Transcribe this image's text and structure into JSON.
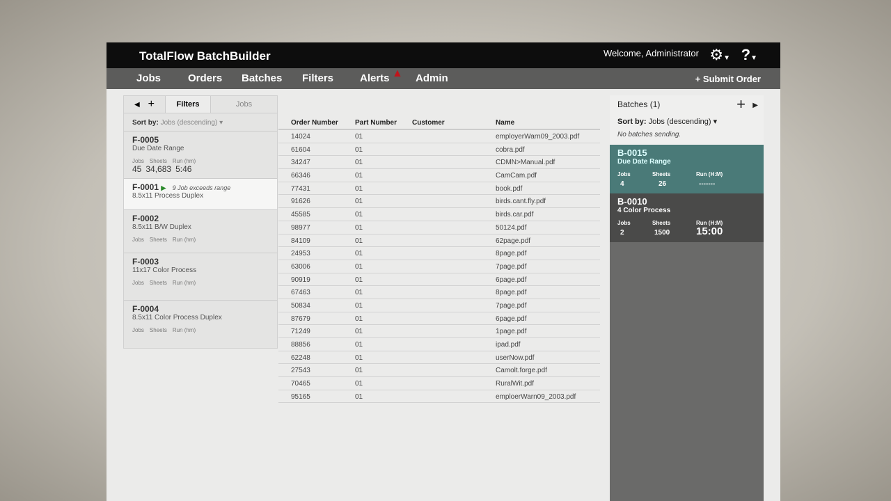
{
  "app": {
    "title": "TotalFlow BatchBuilder",
    "welcome": "Welcome, Administrator",
    "gear_icon": "gear-icon",
    "help_icon": "help-icon"
  },
  "nav": {
    "items": [
      "Jobs",
      "Orders",
      "Batches",
      "Filters",
      "Alerts",
      "Admin"
    ],
    "submit": "+ Submit Order",
    "alert_icon": "warning-icon",
    "alert_color": "#c0141b"
  },
  "filters": {
    "tabs": [
      "Filters",
      "Jobs"
    ],
    "sort_label": "Sort by:",
    "sort_value": "Jobs (descending)",
    "labels": {
      "jobs": "Jobs",
      "sheets": "Sheets",
      "run": "Run (hm)"
    },
    "items": [
      {
        "id": "F-0005",
        "name": "Due Date Range",
        "jobs": "45",
        "sheets": "34,683",
        "run": "5:46"
      },
      {
        "id": "F-0001",
        "name": "8.5x11 Process Duplex",
        "warning": "9 Job exceeds range"
      },
      {
        "id": "F-0002",
        "name": "8.5x11 B/W Duplex"
      },
      {
        "id": "F-0003",
        "name": "11x17 Color Process"
      },
      {
        "id": "F-0004",
        "name": "8.5x11 Color Process Duplex"
      }
    ]
  },
  "orders": {
    "columns": [
      "Order Number",
      "Part Number",
      "Customer",
      "Name"
    ],
    "rows": [
      [
        "14024",
        "01",
        "",
        "employerWarn09_2003.pdf"
      ],
      [
        "61604",
        "01",
        "",
        "cobra.pdf"
      ],
      [
        "34247",
        "01",
        "",
        "CDMN>Manual.pdf"
      ],
      [
        "66346",
        "01",
        "",
        "CamCam.pdf"
      ],
      [
        "77431",
        "01",
        "",
        "book.pdf"
      ],
      [
        "91626",
        "01",
        "",
        "birds.cant.fly.pdf"
      ],
      [
        "45585",
        "01",
        "",
        "birds.car.pdf"
      ],
      [
        "98977",
        "01",
        "",
        "50124.pdf"
      ],
      [
        "84109",
        "01",
        "",
        "62page.pdf"
      ],
      [
        "24953",
        "01",
        "",
        "8page.pdf"
      ],
      [
        "63006",
        "01",
        "",
        "7page.pdf"
      ],
      [
        "90919",
        "01",
        "",
        "6page.pdf"
      ],
      [
        "67463",
        "01",
        "",
        "8page.pdf"
      ],
      [
        "50834",
        "01",
        "",
        "7page.pdf"
      ],
      [
        "87679",
        "01",
        "",
        "6page.pdf"
      ],
      [
        "71249",
        "01",
        "",
        "1page.pdf"
      ],
      [
        "88856",
        "01",
        "",
        "ipad.pdf"
      ],
      [
        "62248",
        "01",
        "",
        "userNow.pdf"
      ],
      [
        "27543",
        "01",
        "",
        "Camolt.forge.pdf"
      ],
      [
        "70465",
        "01",
        "",
        "RuralWit.pdf"
      ],
      [
        "95165",
        "01",
        "",
        "emploerWarn09_2003.pdf"
      ]
    ]
  },
  "batches": {
    "title": "Batches",
    "count": "(1)",
    "sort_label": "Sort by:",
    "sort_value": "Jobs (descending)",
    "status": "No batches sending.",
    "labels": {
      "jobs": "Jobs",
      "sheets": "Sheets",
      "run": "Run (H:M)"
    },
    "items": [
      {
        "id": "B-0015",
        "name": "Due Date Range",
        "jobs": "4",
        "sheets": "26",
        "run": "-------",
        "color": "#4a7a78"
      },
      {
        "id": "B-0010",
        "name": "4 Color Process",
        "jobs": "2",
        "sheets": "1500",
        "run": "15:00",
        "color": "#4a4a49"
      }
    ]
  }
}
